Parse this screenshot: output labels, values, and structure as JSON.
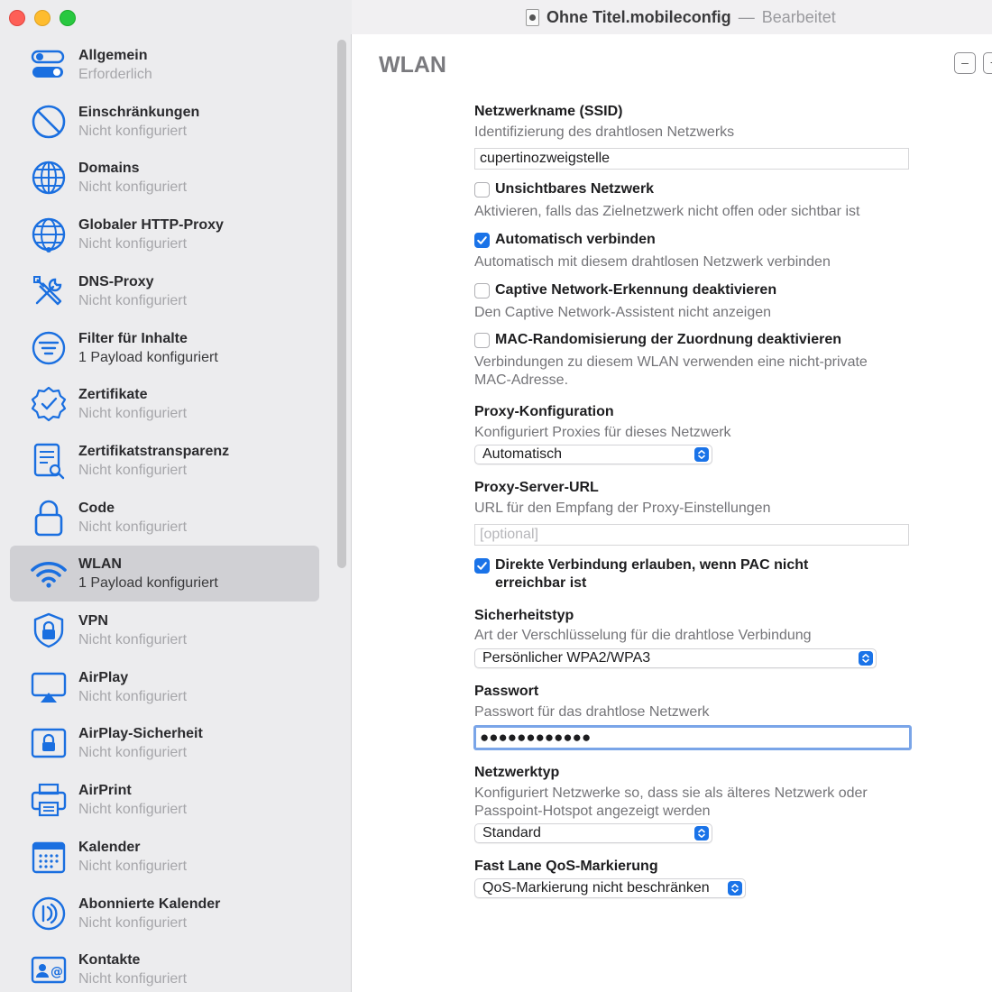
{
  "window": {
    "file_name": "Ohne Titel.mobileconfig",
    "separator": "—",
    "state": "Bearbeitet"
  },
  "sidebar": {
    "items": [
      {
        "label": "Allgemein",
        "status": "Erforderlich",
        "icon": "toggles-icon"
      },
      {
        "label": "Einschränkungen",
        "status": "Nicht konfiguriert",
        "icon": "prohibited-icon"
      },
      {
        "label": "Domains",
        "status": "Nicht konfiguriert",
        "icon": "globe-icon"
      },
      {
        "label": "Globaler HTTP-Proxy",
        "status": "Nicht konfiguriert",
        "icon": "globe-network-icon"
      },
      {
        "label": "DNS-Proxy",
        "status": "Nicht konfiguriert",
        "icon": "tools-icon"
      },
      {
        "label": "Filter für Inhalte",
        "status": "1 Payload konfiguriert",
        "icon": "filter-icon"
      },
      {
        "label": "Zertifikate",
        "status": "Nicht konfiguriert",
        "icon": "certificate-badge-icon"
      },
      {
        "label": "Zertifikatstransparenz",
        "status": "Nicht konfiguriert",
        "icon": "document-search-icon"
      },
      {
        "label": "Code",
        "status": "Nicht konfiguriert",
        "icon": "lock-icon"
      },
      {
        "label": "WLAN",
        "status": "1 Payload konfiguriert",
        "icon": "wifi-icon"
      },
      {
        "label": "VPN",
        "status": "Nicht konfiguriert",
        "icon": "shield-lock-icon"
      },
      {
        "label": "AirPlay",
        "status": "Nicht konfiguriert",
        "icon": "airplay-icon"
      },
      {
        "label": "AirPlay-Sicherheit",
        "status": "Nicht konfiguriert",
        "icon": "airplay-lock-icon"
      },
      {
        "label": "AirPrint",
        "status": "Nicht konfiguriert",
        "icon": "printer-icon"
      },
      {
        "label": "Kalender",
        "status": "Nicht konfiguriert",
        "icon": "calendar-icon"
      },
      {
        "label": "Abonnierte Kalender",
        "status": "Nicht konfiguriert",
        "icon": "broadcast-icon"
      },
      {
        "label": "Kontakte",
        "status": "Nicht konfiguriert",
        "icon": "contact-card-icon"
      }
    ],
    "selected": "WLAN"
  },
  "main": {
    "title": "WLAN",
    "ssid": {
      "title": "Netzwerkname (SSID)",
      "description": "Identifizierung des drahtlosen Netzwerks",
      "value": "cupertinozweigstelle"
    },
    "hidden_network": {
      "label": "Unsichtbares Netzwerk",
      "description": "Aktivieren, falls das Zielnetzwerk nicht offen oder sichtbar ist",
      "checked": false
    },
    "auto_join": {
      "label": "Automatisch verbinden",
      "description": "Automatisch mit diesem drahtlosen Netzwerk verbinden",
      "checked": true
    },
    "captive": {
      "label": "Captive Network-Erkennung deaktivieren",
      "description": "Den Captive Network-Assistent nicht anzeigen",
      "checked": false
    },
    "mac_random": {
      "label": "MAC-Randomisierung der Zuordnung deaktivieren",
      "description_line1": "Verbindungen zu diesem WLAN verwenden eine nicht-private",
      "description_line2": "MAC-Adresse.",
      "checked": false
    },
    "proxy_config": {
      "title": "Proxy-Konfiguration",
      "description": "Konfiguriert Proxies für dieses Netzwerk",
      "value": "Automatisch"
    },
    "proxy_url": {
      "title": "Proxy-Server-URL",
      "description": "URL für den Empfang der Proxy-Einstellungen",
      "placeholder": "[optional]"
    },
    "pac_direct": {
      "label_line1": "Direkte Verbindung erlauben, wenn PAC nicht",
      "label_line2": "erreichbar ist",
      "checked": true
    },
    "security": {
      "title": "Sicherheitstyp",
      "description": "Art der Verschlüsselung für die drahtlose Verbindung",
      "value": "Persönlicher WPA2/WPA3"
    },
    "password": {
      "title": "Passwort",
      "description": "Passwort für das drahtlose Netzwerk",
      "masked_value": "●●●●●●●●●●●●"
    },
    "network_type": {
      "title": "Netzwerktyp",
      "description_line1": "Konfiguriert Netzwerke so, dass sie als älteres Netzwerk oder",
      "description_line2": "Passpoint-Hotspot angezeigt werden",
      "value": "Standard"
    },
    "qos": {
      "title": "Fast Lane QoS-Markierung",
      "value": "QoS-Markierung nicht beschränken"
    }
  },
  "colors": {
    "accent": "#1a73e8",
    "sidebar_bg": "#ececee",
    "selected_bg": "#d0d0d4",
    "icon_blue": "#1a6fe0",
    "muted_text": "#a6a6aa"
  }
}
